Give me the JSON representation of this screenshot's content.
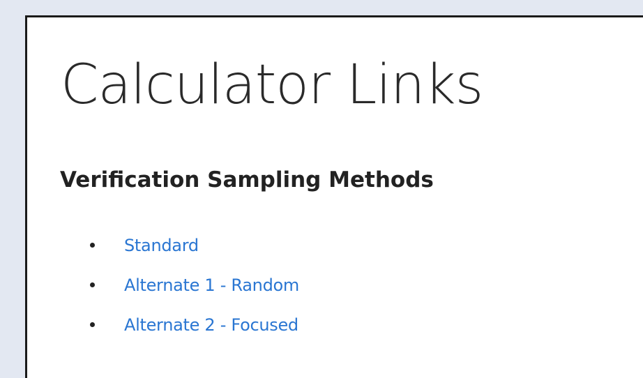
{
  "page": {
    "title": "Calculator Links"
  },
  "section": {
    "heading": "Verification Sampling Methods",
    "links": [
      {
        "label": "Standard"
      },
      {
        "label": "Alternate 1 - Random"
      },
      {
        "label": "Alternate 2 - Focused"
      }
    ]
  },
  "colors": {
    "background": "#e3e8f2",
    "panel": "#ffffff",
    "link": "#2a76d2",
    "heading": "#222222"
  }
}
